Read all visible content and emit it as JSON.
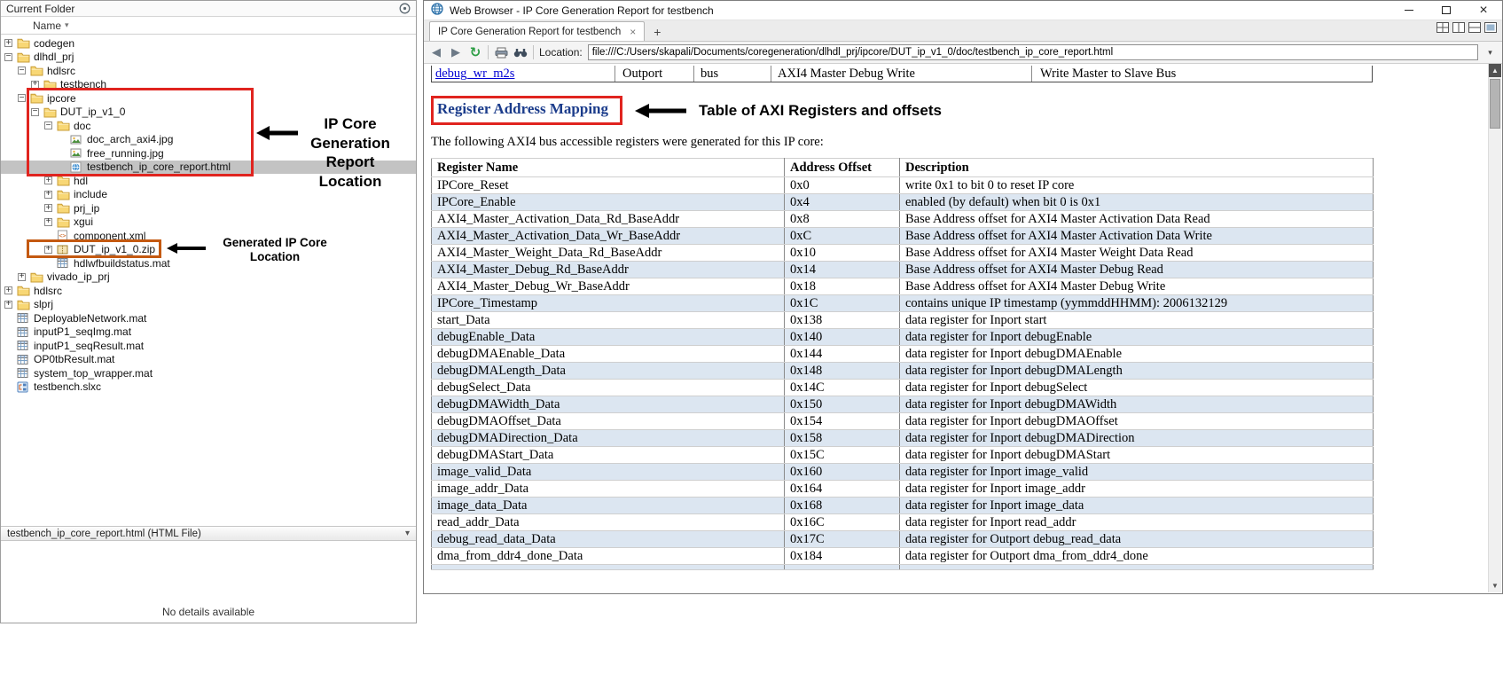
{
  "colors": {
    "annotation_red": "#e0241f",
    "annotation_orange": "#c45911",
    "table_stripe_blue": "#dce6f1",
    "heading_blue": "#1b3c8b",
    "link_blue": "#0000d4",
    "selection_gray": "#c3c3c3"
  },
  "glyphs": {
    "sort": "▾",
    "chevron": "▾",
    "scroll_up": "▲",
    "scroll_down": "▼",
    "close": "×",
    "tab_close": "×",
    "plus": "+",
    "back": "◀",
    "forward": "▶",
    "refresh": "↻"
  },
  "annotations": {
    "report_location": "IP Core Generation Report Location",
    "zip_location": "Generated IP Core Location",
    "register_table": "Table of AXI Registers and offsets"
  },
  "left_panel": {
    "title": "Current Folder",
    "column_header": "Name",
    "details_bar": "testbench_ip_core_report.html  (HTML File)",
    "details_empty": "No details available",
    "tree": [
      {
        "label": "codegen",
        "level": 0,
        "expander": "+",
        "icon": "folder"
      },
      {
        "label": "dlhdl_prj",
        "level": 0,
        "expander": "-",
        "icon": "folder"
      },
      {
        "label": "hdlsrc",
        "level": 1,
        "expander": "-",
        "icon": "folder"
      },
      {
        "label": "testbench",
        "level": 2,
        "expander": "+",
        "icon": "folder"
      },
      {
        "label": "ipcore",
        "level": 1,
        "expander": "-",
        "icon": "folder"
      },
      {
        "label": "DUT_ip_v1_0",
        "level": 2,
        "expander": "-",
        "icon": "folder"
      },
      {
        "label": "doc",
        "level": 3,
        "expander": "-",
        "icon": "folder"
      },
      {
        "label": "doc_arch_axi4.jpg",
        "level": 4,
        "expander": null,
        "icon": "image"
      },
      {
        "label": "free_running.jpg",
        "level": 4,
        "expander": null,
        "icon": "image"
      },
      {
        "label": "testbench_ip_core_report.html",
        "level": 4,
        "expander": null,
        "icon": "html",
        "selected": true
      },
      {
        "label": "hdl",
        "level": 3,
        "expander": "+",
        "icon": "folder"
      },
      {
        "label": "include",
        "level": 3,
        "expander": "+",
        "icon": "folder"
      },
      {
        "label": "prj_ip",
        "level": 3,
        "expander": "+",
        "icon": "folder"
      },
      {
        "label": "xgui",
        "level": 3,
        "expander": "+",
        "icon": "folder"
      },
      {
        "label": "component.xml",
        "level": 3,
        "expander": null,
        "icon": "xml"
      },
      {
        "label": "DUT_ip_v1_0.zip",
        "level": 3,
        "expander": "+",
        "icon": "zip"
      },
      {
        "label": "hdlwfbuildstatus.mat",
        "level": 3,
        "expander": null,
        "icon": "mat"
      },
      {
        "label": "vivado_ip_prj",
        "level": 1,
        "expander": "+",
        "icon": "folder"
      },
      {
        "label": "hdlsrc",
        "level": 0,
        "expander": "+",
        "icon": "folder"
      },
      {
        "label": "slprj",
        "level": 0,
        "expander": "+",
        "icon": "folder"
      },
      {
        "label": "DeployableNetwork.mat",
        "level": 0,
        "expander": null,
        "icon": "mat"
      },
      {
        "label": "inputP1_seqImg.mat",
        "level": 0,
        "expander": null,
        "icon": "mat"
      },
      {
        "label": "inputP1_seqResult.mat",
        "level": 0,
        "expander": null,
        "icon": "mat"
      },
      {
        "label": "OP0tbResult.mat",
        "level": 0,
        "expander": null,
        "icon": "mat"
      },
      {
        "label": "system_top_wrapper.mat",
        "level": 0,
        "expander": null,
        "icon": "mat"
      },
      {
        "label": "testbench.slxc",
        "level": 0,
        "expander": null,
        "icon": "slxc"
      }
    ]
  },
  "browser": {
    "window_title": "Web Browser - IP Core Generation Report for testbench",
    "tab_title": "IP Core Generation Report for testbench",
    "location_label": "Location:",
    "url": "file:///C:/Users/skapali/Documents/coregeneration/dlhdl_prj/ipcore/DUT_ip_v1_0/doc/testbench_ip_core_report.html",
    "report": {
      "ports_row": {
        "name": "debug_wr_m2s",
        "direction": "Outport",
        "datatype": "bus",
        "purpose": "AXI4 Master Debug Write",
        "description": "Write Master to Slave Bus"
      },
      "heading": "Register Address Mapping",
      "intro": "The following AXI4 bus accessible registers were generated for this IP core:",
      "table_headers": [
        "Register Name",
        "Address Offset",
        "Description"
      ],
      "registers": [
        [
          "IPCore_Reset",
          "0x0",
          "write 0x1 to bit 0 to reset IP core"
        ],
        [
          "IPCore_Enable",
          "0x4",
          "enabled (by default) when bit 0 is 0x1"
        ],
        [
          "AXI4_Master_Activation_Data_Rd_BaseAddr",
          "0x8",
          "Base Address offset for AXI4 Master Activation Data Read"
        ],
        [
          "AXI4_Master_Activation_Data_Wr_BaseAddr",
          "0xC",
          "Base Address offset for AXI4 Master Activation Data Write"
        ],
        [
          "AXI4_Master_Weight_Data_Rd_BaseAddr",
          "0x10",
          "Base Address offset for AXI4 Master Weight Data Read"
        ],
        [
          "AXI4_Master_Debug_Rd_BaseAddr",
          "0x14",
          "Base Address offset for AXI4 Master Debug Read"
        ],
        [
          "AXI4_Master_Debug_Wr_BaseAddr",
          "0x18",
          "Base Address offset for AXI4 Master Debug Write"
        ],
        [
          "IPCore_Timestamp",
          "0x1C",
          "contains unique IP timestamp (yymmddHHMM): 2006132129"
        ],
        [
          "start_Data",
          "0x138",
          "data register for Inport start"
        ],
        [
          "debugEnable_Data",
          "0x140",
          "data register for Inport debugEnable"
        ],
        [
          "debugDMAEnable_Data",
          "0x144",
          "data register for Inport debugDMAEnable"
        ],
        [
          "debugDMALength_Data",
          "0x148",
          "data register for Inport debugDMALength"
        ],
        [
          "debugSelect_Data",
          "0x14C",
          "data register for Inport debugSelect"
        ],
        [
          "debugDMAWidth_Data",
          "0x150",
          "data register for Inport debugDMAWidth"
        ],
        [
          "debugDMAOffset_Data",
          "0x154",
          "data register for Inport debugDMAOffset"
        ],
        [
          "debugDMADirection_Data",
          "0x158",
          "data register for Inport debugDMADirection"
        ],
        [
          "debugDMAStart_Data",
          "0x15C",
          "data register for Inport debugDMAStart"
        ],
        [
          "image_valid_Data",
          "0x160",
          "data register for Inport image_valid"
        ],
        [
          "image_addr_Data",
          "0x164",
          "data register for Inport image_addr"
        ],
        [
          "image_data_Data",
          "0x168",
          "data register for Inport image_data"
        ],
        [
          "read_addr_Data",
          "0x16C",
          "data register for Inport read_addr"
        ],
        [
          "debug_read_data_Data",
          "0x17C",
          "data register for Outport debug_read_data"
        ],
        [
          "dma_from_ddr4_done_Data",
          "0x184",
          "data register for Outport dma_from_ddr4_done"
        ]
      ]
    }
  }
}
